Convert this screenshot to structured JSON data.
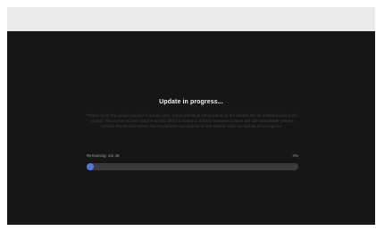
{
  "colors": {
    "screen_background": "#161616",
    "accent": "#4f76e8",
    "track": "#3a3a3a"
  },
  "update": {
    "title": "Update in progress...",
    "message": "Please keep the vehicle parked in a safe area. Some electrical components in the vehicle will be disabled during the update. The center screen may be turned off for a moment. If some features or apps are still unavailable, please contact the service center. Do not perform any actions on the vehicle while an update is in progress.",
    "remaining_label": "Remaining: 1m 48",
    "percent_label": "3%",
    "progress": 0.03
  }
}
